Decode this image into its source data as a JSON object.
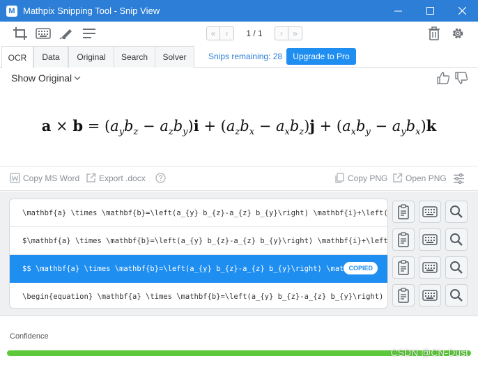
{
  "window": {
    "title": "Mathpix Snipping Tool - Snip View",
    "logo_text": "M"
  },
  "toolbar": {
    "icons": [
      "crop-screen-icon",
      "keyboard-icon",
      "pen-icon",
      "menu-icon",
      "trash-icon",
      "gear-icon"
    ],
    "pager": {
      "first": "«",
      "prev": "‹",
      "label": "1 / 1",
      "next": "›",
      "last": "»"
    }
  },
  "tabs": [
    {
      "label": "OCR",
      "active": true
    },
    {
      "label": "Data",
      "active": false
    },
    {
      "label": "Original",
      "active": false
    },
    {
      "label": "Search",
      "active": false
    },
    {
      "label": "Solver",
      "active": false
    }
  ],
  "snips_remaining": "Snips remaining: 28",
  "upgrade_label": "Upgrade to Pro",
  "show_original_label": "Show Original",
  "actions": {
    "copy_ms_word": "Copy MS Word",
    "export_docx": "Export .docx",
    "copy_png": "Copy PNG",
    "open_png": "Open PNG"
  },
  "results": [
    {
      "text": "\\mathbf{a} \\times \\mathbf{b}=\\left(a_{y} b_{z}-a_{z} b_{y}\\right) \\mathbf{i}+\\left(a_",
      "selected": false
    },
    {
      "text": "$\\mathbf{a} \\times \\mathbf{b}=\\left(a_{y} b_{z}-a_{z} b_{y}\\right) \\mathbf{i}+\\left(a",
      "selected": false
    },
    {
      "text": "$$  \\mathbf{a} \\times \\mathbf{b}=\\left(a_{y} b_{z}-a_{z} b_{y}\\right) \\mathbf",
      "selected": true
    },
    {
      "text": "\\begin{equation}  \\mathbf{a} \\times \\mathbf{b}=\\left(a_{y} b_{z}-a_{z} b_{y}\\right) \\",
      "selected": false
    }
  ],
  "copied_badge": "COPIED",
  "confidence": {
    "label": "Confidence",
    "value": 1.0,
    "color": "#5cc83a"
  },
  "watermark": "CSDN @CN-Dust",
  "colors": {
    "accent": "#1f8ef1",
    "titlebar": "#2c7ed6"
  }
}
